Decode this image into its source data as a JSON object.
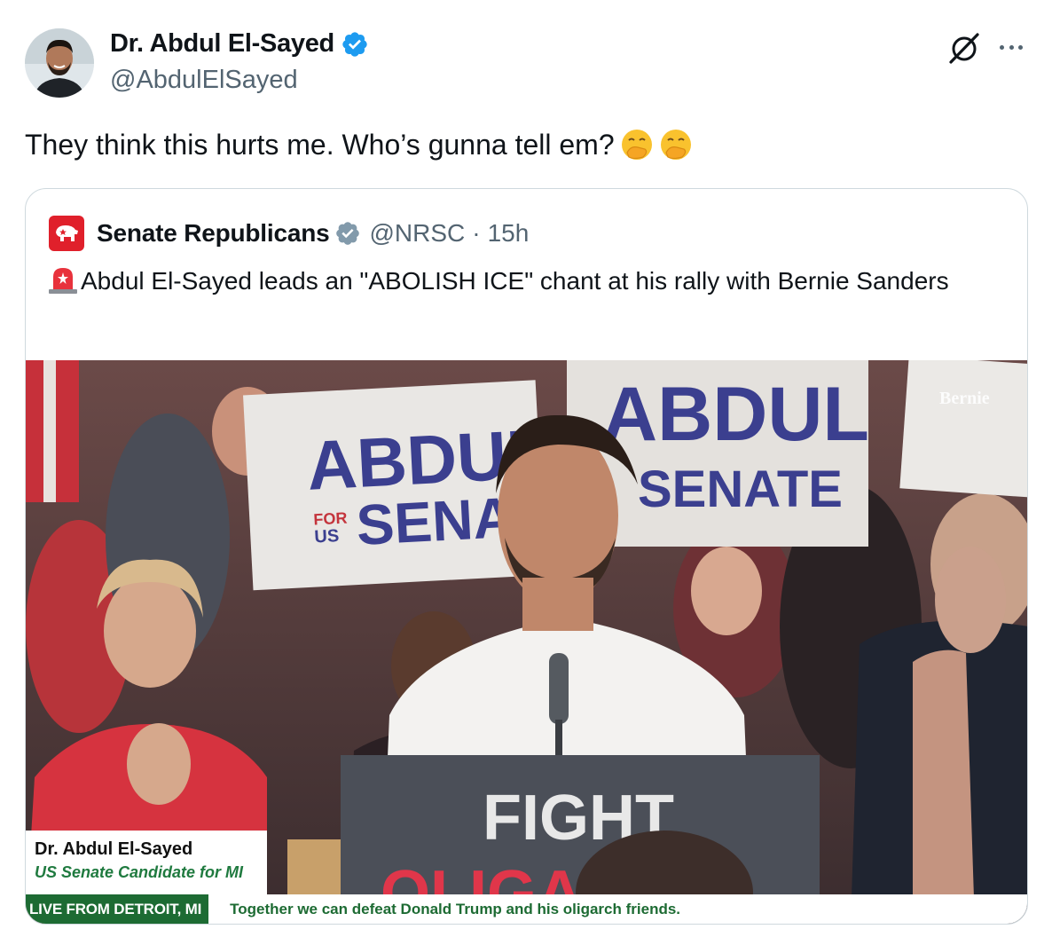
{
  "author": {
    "display_name": "Dr. Abdul El-Sayed",
    "handle": "@AbdulElSayed"
  },
  "tweet": {
    "text": "They think this hurts me. Who’s gunna tell em?"
  },
  "icons": {
    "grok": "grok-icon",
    "more": "more-icon",
    "verified": "verified-badge-icon",
    "emoji": "hand-over-mouth-emoji"
  },
  "quoted_tweet": {
    "display_name": "Senate Republicans",
    "handle": "@NRSC",
    "separator": "·",
    "time": "15h",
    "text": "Abdul El-Sayed leads an \"ABOLISH ICE\" chant at his rally with Bernie Sanders",
    "media": {
      "lower_third_name": "Dr. Abdul El-Sayed",
      "lower_third_title": "US Senate Candidate for MI",
      "ticker_live": "LIVE FROM DETROIT, MI",
      "ticker_message": "Together we can defeat Donald Trump and his oligarch friends.",
      "watermark": "Bernie",
      "sign_line1": "ABDUL",
      "sign_for": "FOR",
      "sign_us": "US",
      "sign_senate": "SENATE",
      "podium_line1": "FIGHT",
      "podium_line2": "OLIGAR"
    }
  },
  "colors": {
    "verified_blue": "#1d9bf0",
    "gov_gray": "#829aab",
    "nrsc_red": "#e0202b",
    "ticker_green": "#1d6b33"
  }
}
